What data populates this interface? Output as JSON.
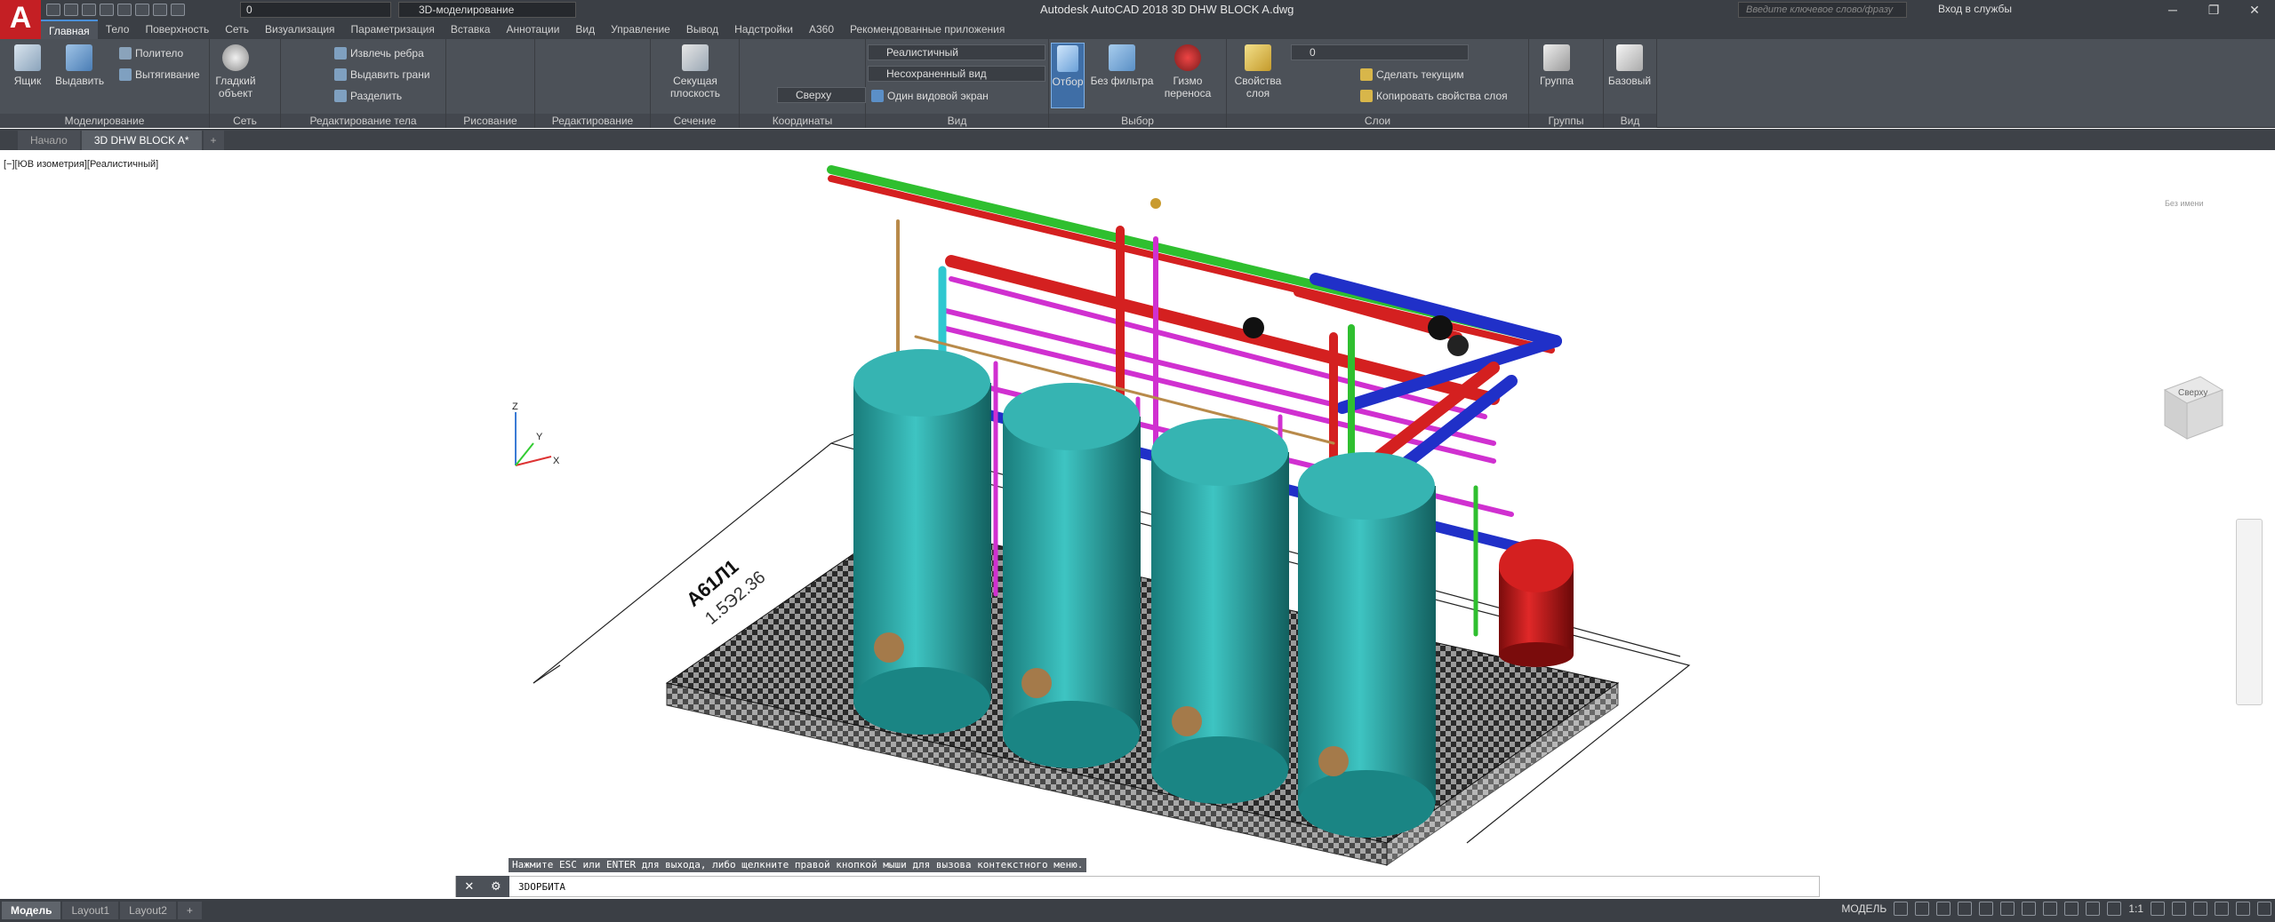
{
  "app": {
    "logo_letter": "A",
    "title": "Autodesk AutoCAD 2018    3D DHW BLOCK A.dwg",
    "layer_current": "0",
    "workspace": "3D-моделирование",
    "search_placeholder": "Введите ключевое слово/фразу",
    "sign_in": "Вход в службы"
  },
  "menu": [
    "Главная",
    "Тело",
    "Поверхность",
    "Сеть",
    "Визуализация",
    "Параметризация",
    "Вставка",
    "Аннотации",
    "Вид",
    "Управление",
    "Вывод",
    "Надстройки",
    "A360",
    "Рекомендованные приложения"
  ],
  "ribbon": {
    "modeling": {
      "title": "Моделирование",
      "box": "Ящик",
      "extrude": "Выдавить",
      "polysolid": "Политело",
      "presspull": "Вытягивание"
    },
    "mesh": {
      "title": "Сеть",
      "smooth": "Гладкий объект"
    },
    "solid_edit": {
      "title": "Редактирование тела",
      "extract": "Извлечь ребра",
      "extrude_faces": "Выдавить грани",
      "separate": "Разделить"
    },
    "draw": {
      "title": "Рисование"
    },
    "modify": {
      "title": "Редактирование"
    },
    "section": {
      "title": "Сечение",
      "plane": "Секущая плоскость"
    },
    "coords": {
      "title": "Координаты"
    },
    "view": {
      "title": "Вид",
      "visual_style": "Реалистичный",
      "named_view": "Несохраненный вид",
      "view_dir": "Сверху",
      "viewports": "Один видовой экран"
    },
    "selection": {
      "title": "Выбор",
      "culling": "Отбор",
      "nofilter": "Без фильтра",
      "gizmo": "Гизмо переноса"
    },
    "layers": {
      "title": "Слои",
      "props": "Свойства слоя",
      "layer_value": "0",
      "make_current": "Сделать текущим",
      "match": "Копировать свойства слоя"
    },
    "groups": {
      "title": "Группы",
      "group": "Группа"
    },
    "view2": {
      "title": "Вид",
      "base": "Базовый"
    }
  },
  "tabs": [
    "Начало",
    "3D DHW BLOCK A*"
  ],
  "viewport": {
    "label": "[−][ЮВ изометрия][Реалистичный]",
    "viewcube_face": "Сверху",
    "wcs_label": "Без имени",
    "annotation_1": "A61Л1",
    "annotation_2": "1.5Э2.36"
  },
  "command": {
    "history": "Нажмите ESC или ENTER для выхода, либо щелкните правой кнопкой мыши для вызова контекстного меню.",
    "current": "3DОРБИТА"
  },
  "status": {
    "layout_tabs": [
      "Модель",
      "Layout1",
      "Layout2"
    ],
    "model_label": "МОДЕЛЬ",
    "scale": "1:1"
  },
  "colors": {
    "tank": "#2aa6a4",
    "pipe_red": "#d42020",
    "pipe_blue": "#2030c8",
    "pipe_green": "#2fbf2f",
    "pipe_magenta": "#d030d0",
    "pipe_cyan": "#30c8d0",
    "expansion_vessel": "#c81818"
  }
}
